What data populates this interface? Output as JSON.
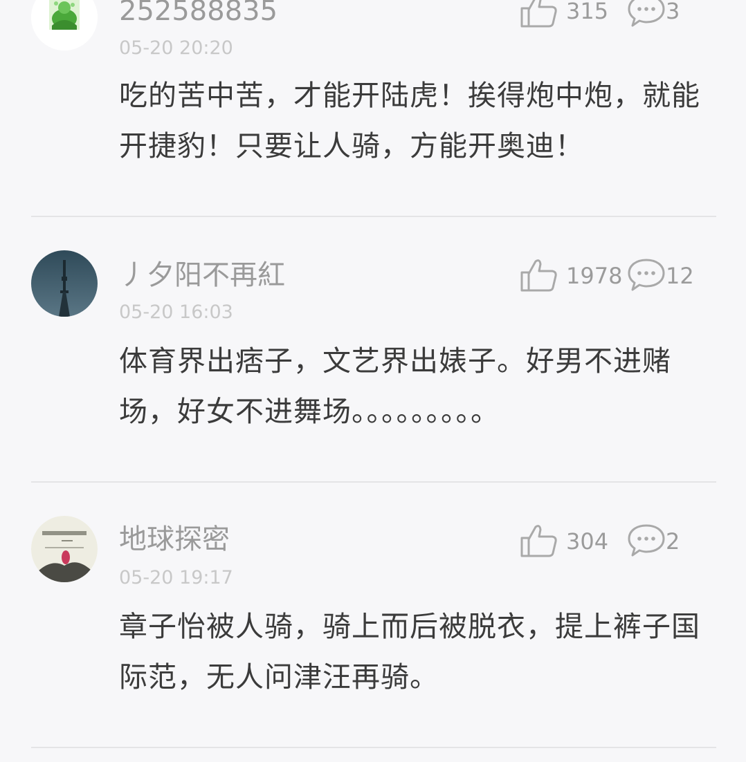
{
  "comments": [
    {
      "username": "252588835",
      "timestamp": "05-20 20:20",
      "likes": "315",
      "replies": "3",
      "text": "吃的苦中苦，才能开陆虎！挨得炮中炮，就能开捷豹！只要让人骑，方能开奥迪！",
      "avatar_icon": "green-figure-avatar"
    },
    {
      "username": "丿夕阳不再紅",
      "timestamp": "05-20 16:03",
      "likes": "1978",
      "replies": "12",
      "text": "体育界出痞子，文艺界出婊子。好男不进赌场，好女不进舞场。。。。。。。。。",
      "avatar_icon": "tower-avatar"
    },
    {
      "username": "地球探密",
      "timestamp": "05-20 19:17",
      "likes": "304",
      "replies": "2",
      "text": "章子怡被人骑，骑上而后被脱衣，提上裤子国际范，无人问津汪再骑。",
      "avatar_icon": "ink-painting-avatar"
    }
  ],
  "icons": {
    "like": "thumbs-up-icon",
    "reply": "speech-bubble-icon"
  },
  "colors": {
    "background": "#f7f7f9",
    "username": "#9a9a9a",
    "timestamp": "#c8c8c8",
    "body": "#3b3b3b",
    "divider": "#e4e4e6"
  }
}
